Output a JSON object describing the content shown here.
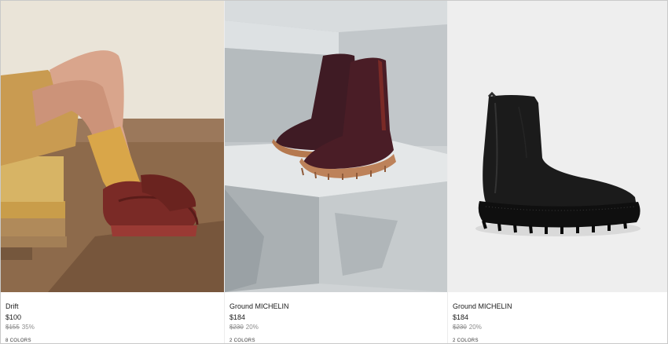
{
  "products": [
    {
      "name": "Drift",
      "price": "$100",
      "original_price": "$155",
      "discount": "35%",
      "colors": "8 COLORS",
      "image": "burgundy leather sneakers worn with mustard socks on wooden floor"
    },
    {
      "name": "Ground MICHELIN",
      "price": "$184",
      "original_price": "$230",
      "discount": "20%",
      "colors": "2 COLORS",
      "image": "burgundy ankle boots with Michelin sole on concrete steps"
    },
    {
      "name": "Ground MICHELIN",
      "price": "$184",
      "original_price": "$230",
      "discount": "20%",
      "colors": "2 COLORS",
      "image": "black ankle boot with chunky black sole"
    }
  ],
  "colors": {
    "burgundy": "#7a2a26",
    "plum": "#4a1d26",
    "sole_tan": "#b87a54",
    "black": "#1b1b1b",
    "muted_text": "#8c8c8c"
  }
}
